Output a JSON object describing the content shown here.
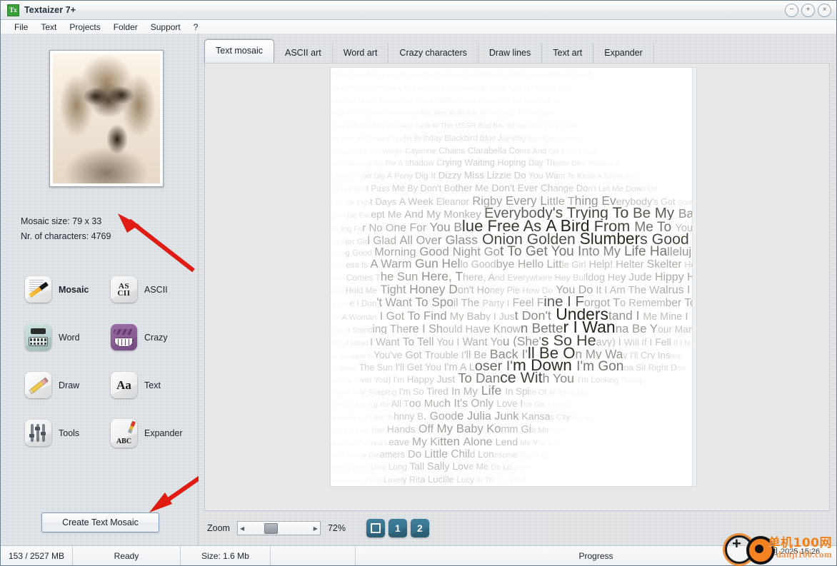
{
  "window": {
    "title": "Textaizer 7+",
    "app_icon": "Tx",
    "controls": [
      {
        "name": "minimize",
        "glyph": "−"
      },
      {
        "name": "maximize",
        "glyph": "+"
      },
      {
        "name": "close",
        "glyph": "×"
      }
    ]
  },
  "menu": {
    "items": [
      "File",
      "Text",
      "Projects",
      "Folder",
      "Support",
      "?"
    ]
  },
  "sidebar": {
    "thumbnail_alt": "source portrait photo",
    "mosaic_size_label": "Mosaic size: 79 x 33",
    "characters_label": "Nr. of characters: 4769",
    "mode_icons": [
      {
        "label": "Mosaic",
        "icon": "mosaic-pen-icon",
        "selected": true
      },
      {
        "label": "ASCII",
        "icon": "ascii-icon",
        "selected": false
      },
      {
        "label": "Word",
        "icon": "typewriter-icon",
        "selected": false
      },
      {
        "label": "Crazy",
        "icon": "crazy-face-icon",
        "selected": false
      },
      {
        "label": "Draw",
        "icon": "pencil-icon",
        "selected": false
      },
      {
        "label": "Text",
        "icon": "aa-letters-icon",
        "selected": false
      },
      {
        "label": "Tools",
        "icon": "sliders-icon",
        "selected": false
      },
      {
        "label": "Expander",
        "icon": "paintbrush-abc-icon",
        "selected": false
      }
    ],
    "ascii_icon_text": "AS CII",
    "text_icon_text": "Aa",
    "expander_icon_text": "ABC",
    "create_button": "Create Text Mosaic"
  },
  "tabs": [
    {
      "label": "Text mosaic",
      "active": true
    },
    {
      "label": "ASCII art",
      "active": false
    },
    {
      "label": "Word art",
      "active": false
    },
    {
      "label": "Crazy characters",
      "active": false
    },
    {
      "label": "Draw lines",
      "active": false
    },
    {
      "label": "Text art",
      "active": false
    },
    {
      "label": "Expander",
      "active": false
    }
  ],
  "mosaic": {
    "lines": [
      "12 Bar Original A Beginning A Day In The Life A Hard Day's Night A Shot Of Rhythm and Blues A Taste O",
      "f Honey Across The Universe Act Naturally Ain't She Sweet All I've Got To Do All My Loving All T",
      "hings Must Pass All Together Now All You Need Is Love And I Love Her And Your Bird Can",
      " Sing Anna (Go To Him) Another Girl Any Time At All Ask Me Why Baby It's You Baby Y",
      "ou're A Rich Man Baby's In Black Back In The USSR Bad Boy Because Being For The Be",
      "nefit Of Mr. Kite Besame Mucho Birthday Blackbird Blue Jay Way Boys Can't Buy Me L",
      "ove Carol Carry That Weight Cayenne Chains Clarabella Come And Get It Come Toget",
      "her Cry Baby Cry Cry For A Shadow Crying Waiting Hoping Day Tripper Dear Prudence D",
      "ev I In Her Heart Dig A Pony Dig It Dizzy Miss Lizzie Do You Want To Know A Secret Doct",
      "or Robert Don't Pass Me By Don't Bother Me Don't Ever Change Don't Let Me Down Dri",
      "ve My Car Eight Days A Week Eleanor Rigby Every Little Thing Everybody's Got Somethi",
      "ng To Hide Except Me And My Monkey Everybody's Trying To Be My Baby Fixing A Ho",
      "le Flying For No One For You Blue Free As A Bird From Me To You Get Back Gett",
      "ing Better Girl Glad All Over Glass Onion Golden Slumbers Good Day Sunshine Good",
      " Morning Good Morning Good Night Got To Get You Into My Life Hallelujah, I Love Her So",
      " Happiness Is A Warm Gun Hello Goodbye Hello Little Girl Help! Helter Skelter Her Majest",
      "y Here Comes The Sun Here, There, And Everywhere Hey Bulldog Hey Jude Hippy Hippy",
      " Shake Hold Me Tight Honey Don't Honey Pie How Do You Do It I Am The Walrus I Call Y",
      "our Name I Don't Want To Spoil The Party I Feel Fine I Forgot To Remember To Forget",
      " I Got A Woman I Got To Find My Baby I Just Don't Understand I Me Mine I Need You I",
      " Saw Her Standing There I Should Have Known Better I Wanna Be Your Man I Want To H",
      "old Your Hand I Want To Tell You I Want You (She's So Heavy) I Will If I Fell If I Nee",
      "ded Someone If You've Got Trouble I'll Be Back I'll Be On My Way I'll Cry Instea",
      "d I'll Follow The Sun I'll Get You I'm A Loser I'm Down I'm Gonna Sit Right Dow",
      "n And Cry (Over You) I'm Happy Just To Dance With You I'm Looking Through",
      "h You I'm Only Sleeping I'm So Tired In My Life In Spite Of All The Dang",
      "er It Won't Be Long It's All Too Much It's Only Love I've Got A Feeling",
      "I've Just Seen A Face Johnny B. Goode Julia Junk Kansas City/Hey He",
      "y Hey Hey Keep Your Hands Off My Baby Komm Gib Mir Deine",
      " Hand Lady Madonna Leave My Kitten Alone Lend Me Your Com",
      "b Let It Be Like Dreamers Do Little Child Lonesome Tears In My",
      " Eyes Long Long Long Long Tall Sally Love Me Do Love Of Th",
      "e Loved Love You To Lovely Rita Lucille Lucy In The Sky With D"
    ]
  },
  "zoom_controls": {
    "label": "Zoom",
    "percent": "72%",
    "left_arrow": "◀",
    "right_arrow": "▶",
    "buttons": [
      {
        "name": "fit-to-window",
        "label": ""
      },
      {
        "name": "zoom-preset-1",
        "label": "1"
      },
      {
        "name": "zoom-preset-2",
        "label": "2"
      }
    ],
    "accent_color": "#35708c"
  },
  "statusbar": {
    "memory": "153 / 2527 MB",
    "state": "Ready",
    "size": "Size: 1.6 Mb",
    "progress": "Progress"
  },
  "watermark": {
    "chinese": "单机100网",
    "english": "danji100.com",
    "date": "月 2025  15:26",
    "color": "#f07f1a"
  }
}
